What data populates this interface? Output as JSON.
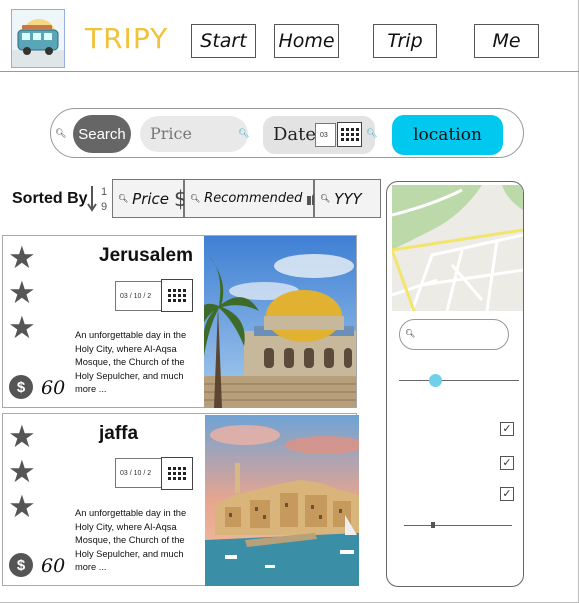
{
  "brand": "TRIPY",
  "nav": [
    "Start",
    "Home",
    "Trip",
    "Me"
  ],
  "search": {
    "button_label": "Search",
    "price_placeholder": "Price",
    "date_label": "Date",
    "date_value": "03",
    "location_label": "location"
  },
  "sort": {
    "label": "Sorted By",
    "order_top": "1",
    "order_bottom": "9",
    "options": [
      "Price",
      "Recommended",
      "YYY"
    ]
  },
  "cards": [
    {
      "title": "Jerusalem",
      "date": "03 / 10 / 2",
      "description": "An unforgettable day in the Holy City, where Al-Aqsa Mosque, the Church of the Holy Sepulcher, and much more ...",
      "price": "60",
      "stars": 3
    },
    {
      "title": "jaffa",
      "date": "03 / 10 / 2",
      "description": "An unforgettable day in the Holy City, where Al-Aqsa Mosque, the Church of the Holy Sepulcher, and much more ...",
      "price": "60",
      "stars": 3
    }
  ],
  "filters": {
    "search_value": "",
    "slider_level": 0.3,
    "range_level": 0.27,
    "checkboxes": [
      true,
      true,
      true
    ]
  },
  "colors": {
    "brand": "#f2c23a",
    "location": "#00c8ee",
    "slider": "#6fd0e8",
    "button": "#666666"
  },
  "icons": [
    "search-icon",
    "calendar-icon",
    "dollar-icon",
    "thumbs-up-icon",
    "star-icon",
    "sort-icon",
    "checkbox-icon"
  ]
}
